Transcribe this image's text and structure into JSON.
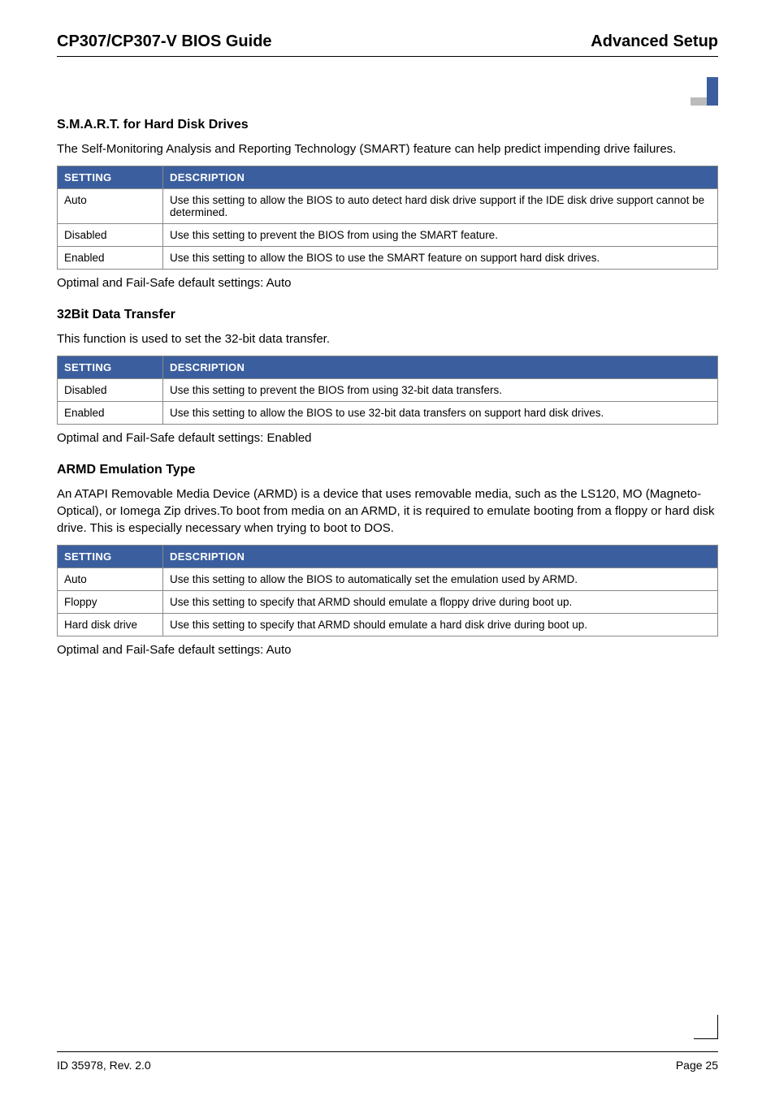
{
  "header": {
    "left": "CP307/CP307-V BIOS Guide",
    "right": "Advanced Setup"
  },
  "sections": [
    {
      "title": "S.M.A.R.T. for Hard Disk Drives",
      "intro": "The Self-Monitoring Analysis and Reporting Technology (SMART) feature can help predict impending drive failures.",
      "table_headers": {
        "setting": "SETTING",
        "description": "DESCRIPTION"
      },
      "rows": [
        {
          "setting": "Auto",
          "description": "Use this setting to allow the BIOS to auto detect hard disk drive support if the IDE disk drive support cannot be determined."
        },
        {
          "setting": "Disabled",
          "description": "Use this setting to prevent the BIOS from using the SMART feature."
        },
        {
          "setting": "Enabled",
          "description": "Use this setting to allow the BIOS to use the SMART feature on support hard disk drives."
        }
      ],
      "footer": "Optimal and Fail-Safe default settings: Auto"
    },
    {
      "title": "32Bit Data Transfer",
      "intro": "This function is used to set the 32-bit data transfer.",
      "table_headers": {
        "setting": "SETTING",
        "description": "DESCRIPTION"
      },
      "rows": [
        {
          "setting": "Disabled",
          "description": "Use this setting to prevent the BIOS from using 32-bit data transfers."
        },
        {
          "setting": "Enabled",
          "description": "Use this setting to allow the BIOS to use 32-bit data transfers on support hard disk drives."
        }
      ],
      "footer": "Optimal and Fail-Safe default settings: Enabled"
    },
    {
      "title": "ARMD Emulation Type",
      "intro": "An ATAPI Removable Media Device (ARMD) is a device that uses removable media, such as the LS120, MO (Magneto-Optical), or Iomega Zip drives.To boot from media on an ARMD, it is required to emulate booting from a floppy or hard disk drive. This is especially necessary when trying to boot to DOS.",
      "table_headers": {
        "setting": "SETTING",
        "description": "DESCRIPTION"
      },
      "rows": [
        {
          "setting": "Auto",
          "description": "Use this setting to allow the BIOS to automatically set the emulation used by ARMD."
        },
        {
          "setting": "Floppy",
          "description": "Use this setting to specify that ARMD should emulate a floppy drive during boot up."
        },
        {
          "setting": "Hard disk drive",
          "description": "Use this setting to specify that ARMD should emulate a hard disk drive during boot up."
        }
      ],
      "footer": "Optimal and Fail-Safe default settings: Auto"
    }
  ],
  "footer": {
    "left": "ID 35978, Rev. 2.0",
    "right": "Page 25"
  }
}
